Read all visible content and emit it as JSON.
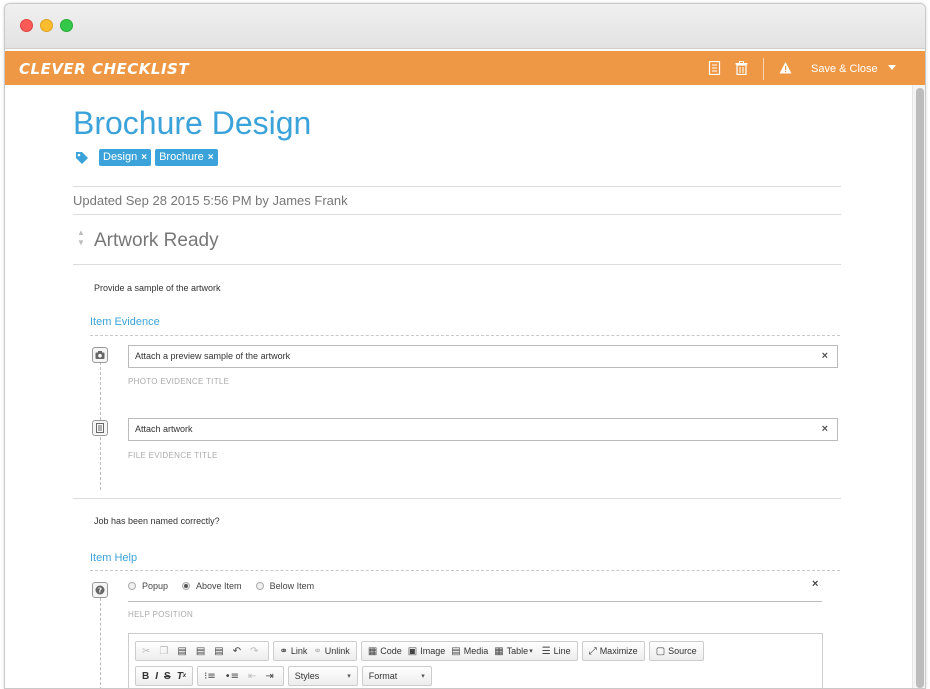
{
  "app": {
    "logo": "CLEVER CHECKLIST",
    "save_close": "Save & Close"
  },
  "checklist": {
    "title": "Brochure Design",
    "tags": [
      {
        "label": "Design"
      },
      {
        "label": "Brochure"
      }
    ],
    "updated": "Updated Sep 28 2015 5:56 PM by James Frank"
  },
  "item": {
    "title": "Artwork Ready",
    "description": "Provide a sample of the artwork",
    "evidence_section": "Item Evidence",
    "evidence": [
      {
        "value": "Attach a preview sample of the artwork",
        "label": "PHOTO EVIDENCE TITLE",
        "icon": "camera-icon"
      },
      {
        "value": "Attach artwork",
        "label": "FILE EVIDENCE TITLE",
        "icon": "file-icon"
      }
    ],
    "note": "Job has been named correctly?",
    "help_section": "Item Help",
    "help_position_label": "HELP POSITION",
    "help_positions": [
      {
        "label": "Popup",
        "selected": false
      },
      {
        "label": "Above Item",
        "selected": true
      },
      {
        "label": "Below Item",
        "selected": false
      }
    ]
  },
  "editor": {
    "link": "Link",
    "unlink": "Unlink",
    "code": "Code",
    "image": "Image",
    "media": "Media",
    "table": "Table",
    "line": "Line",
    "maximize": "Maximize",
    "source": "Source",
    "styles": "Styles",
    "format": "Format"
  },
  "colors": {
    "accent_orange": "#ee9845",
    "accent_blue": "#3ba3d9"
  }
}
